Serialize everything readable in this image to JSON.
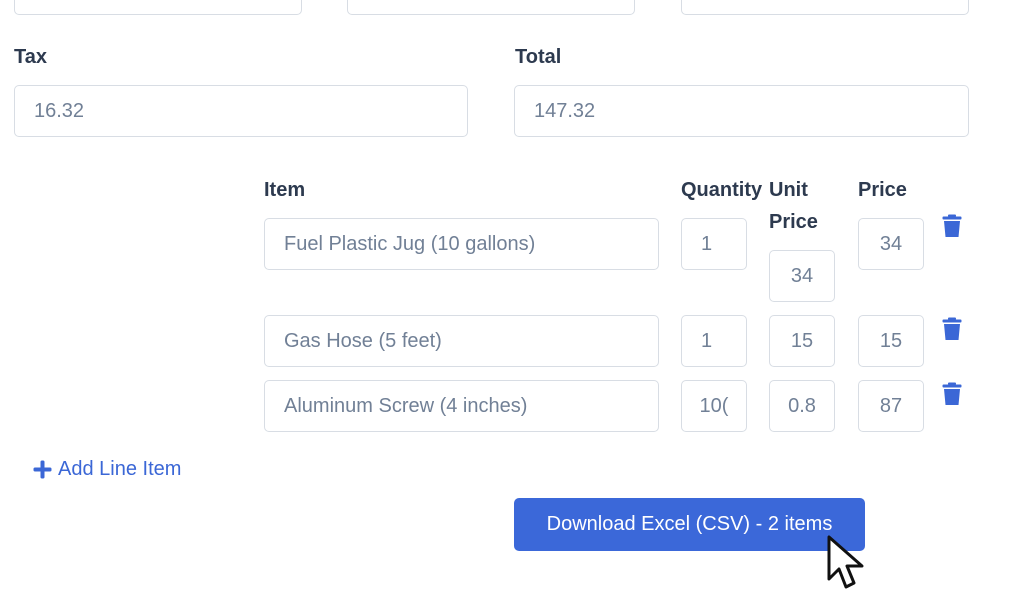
{
  "top_fields": [
    {
      "value": ""
    },
    {
      "value": ""
    },
    {
      "value": ""
    }
  ],
  "tax": {
    "label": "Tax",
    "value": "16.32"
  },
  "total": {
    "label": "Total",
    "value": "147.32"
  },
  "line_items": {
    "headers": {
      "item": "Item",
      "quantity": "Quantity",
      "unit_price_1": "Unit",
      "unit_price_2": "Price",
      "price": "Price"
    },
    "rows": [
      {
        "item": "Fuel Plastic Jug (10 gallons)",
        "quantity": "1",
        "unit_price": "34",
        "price": "34"
      },
      {
        "item": "Gas Hose (5 feet)",
        "quantity": "1",
        "unit_price": "15",
        "price": "15"
      },
      {
        "item": "Aluminum Screw (4 inches)",
        "quantity": "10(",
        "unit_price": "0.8",
        "price": "87"
      }
    ]
  },
  "add_line_item": {
    "icon": "plus-icon",
    "label": "Add Line Item"
  },
  "download_button": {
    "label": "Download Excel (CSV) - 2 items"
  },
  "colors": {
    "accent": "#3b68d9",
    "trash": "#3b67d6"
  }
}
